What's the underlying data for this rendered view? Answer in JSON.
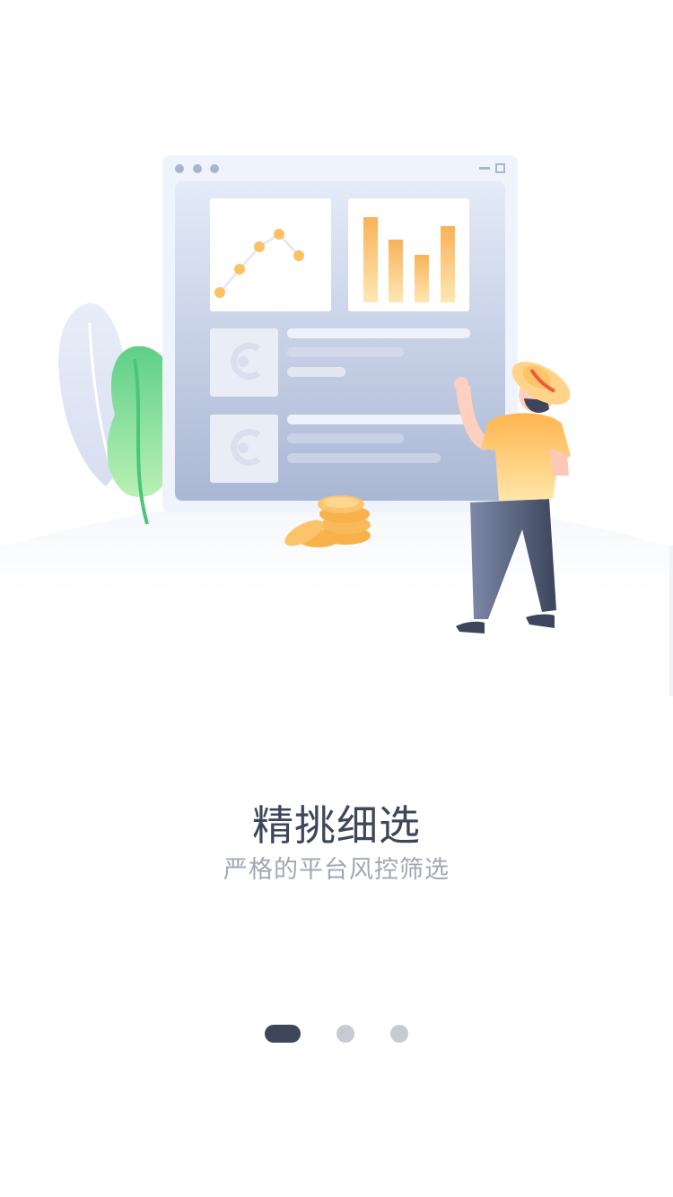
{
  "onboarding": {
    "title": "精挑细选",
    "subtitle": "严格的平台风控筛选",
    "page_count": 3,
    "active_page": 1
  },
  "colors": {
    "title": "#3e4659",
    "subtitle": "#a3a7b3",
    "indicator_active": "#3e4659",
    "indicator_inactive": "#c8cad3",
    "accent_orange": "#f8b04c",
    "leaf_green": "#5fcf88"
  }
}
